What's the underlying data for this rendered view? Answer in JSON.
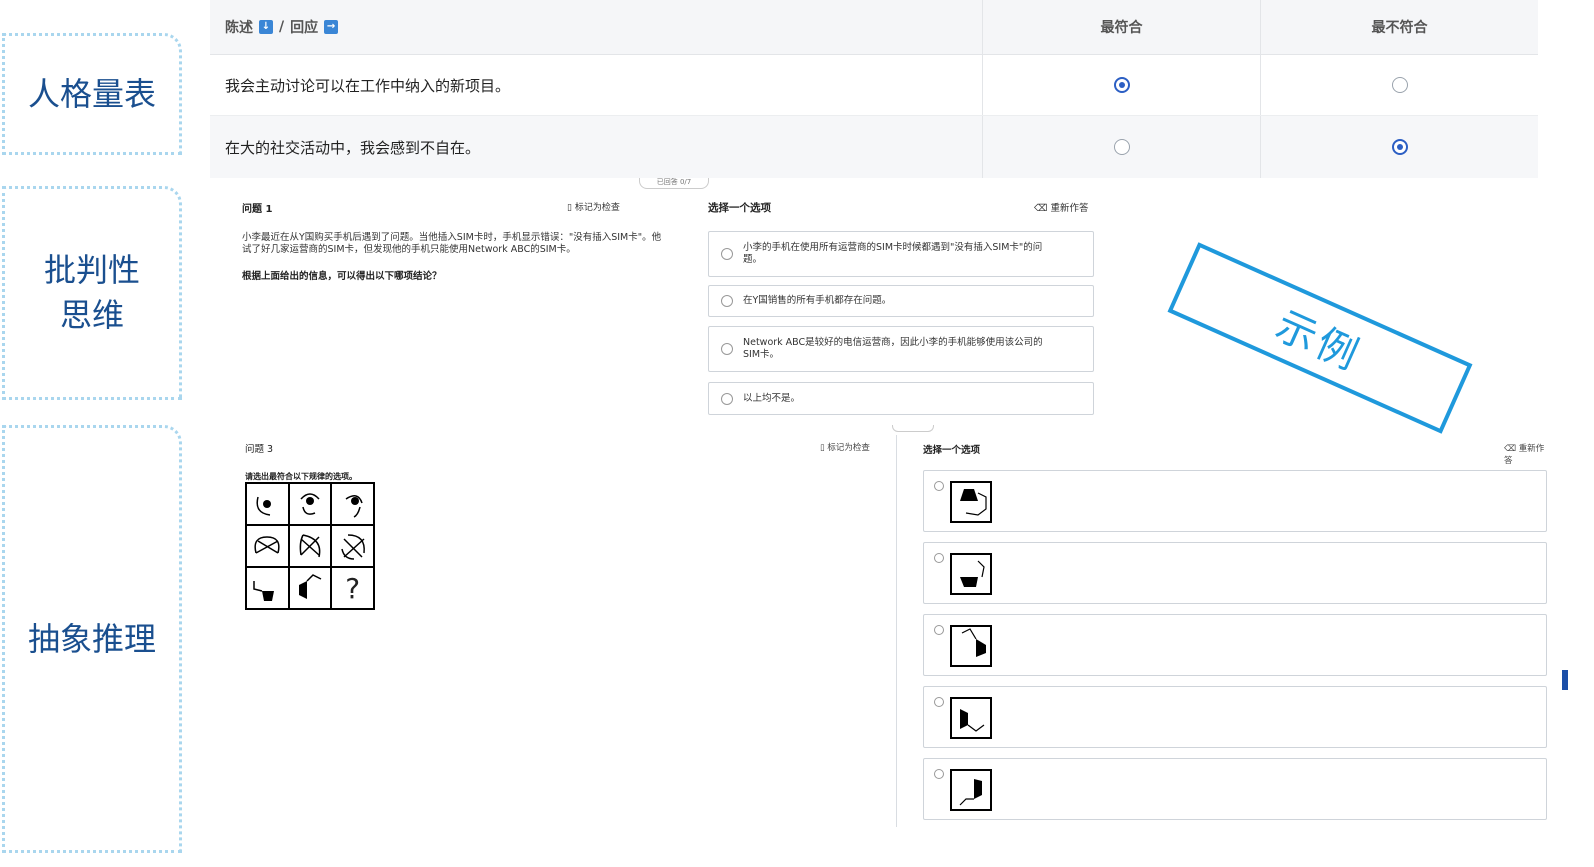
{
  "sidebar": {
    "personality": "人格量表",
    "critical": "批判性\n思维",
    "abstract": "抽象推理"
  },
  "personality_table": {
    "header": {
      "statement": "陈述",
      "slash": "/",
      "response": "回应",
      "most_fit": "最符合",
      "least_fit": "最不符合"
    },
    "rows": [
      {
        "text": "我会主动讨论可以在工作中纳入的新项目。",
        "selected": "most_fit"
      },
      {
        "text": "在大的社交活动中，我会感到不自在。",
        "selected": "least_fit"
      }
    ]
  },
  "critical_thinking": {
    "pill": "已回答 0/7",
    "question_number": "问题 1",
    "mark_review": "标记为检查",
    "question_text": "小李最近在从Y国购买手机后遇到了问题。当他插入SIM卡时，手机显示错误：\"没有插入SIM卡\"。他试了好几家运营商的SIM卡，但发现他的手机只能使用Network ABC的SIM卡。",
    "prompt": "根据上面给出的信息，可以得出以下哪项结论？",
    "choose_label": "选择一个选项",
    "reset_label": "重新作答",
    "options": [
      "小李的手机在使用所有运营商的SIM卡时候都遇到\"没有插入SIM卡\"的问题。",
      "在Y国销售的所有手机都存在问题。",
      "Network ABC是较好的电信运营商，因此小李的手机能够使用该公司的SIM卡。",
      "以上均不是。"
    ]
  },
  "stamp": "示例",
  "abstract_reasoning": {
    "question_number": "问题 3",
    "mark_review": "标记为检查",
    "prompt": "请选出最符合以下规律的选项。",
    "missing": "?",
    "choose_label": "选择一个选项",
    "reset_label": "重新作答"
  }
}
